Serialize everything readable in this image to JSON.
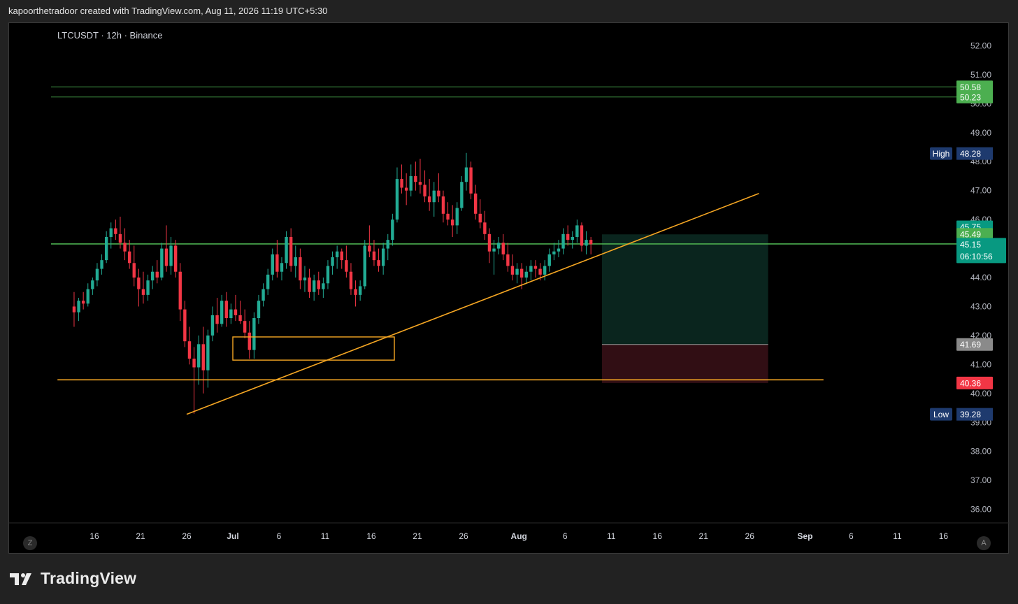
{
  "header": {
    "text": "kapoorthetradoor created with TradingView.com, Aug 11, 2026 11:19 UTC+5:30"
  },
  "chart_title": "LTCUSDT · 12h · Binance",
  "footer": {
    "brand": "TradingView"
  },
  "buttons": {
    "left": "Z",
    "right": "A"
  },
  "colors": {
    "up": "#089981",
    "down": "#f23645",
    "upGreen": "#22ab94",
    "trend": "#f5a623",
    "hline": "#4caf50",
    "high": "#1e3a6e"
  },
  "chart_data": {
    "type": "candlestick",
    "title": "LTCUSDT · 12h · Binance",
    "ylim": [
      35.3,
      52.6
    ],
    "y_ticks": [
      "52.00",
      "51.00",
      "50.00",
      "49.00",
      "48.00",
      "47.00",
      "46.00",
      "45.00",
      "44.00",
      "43.00",
      "42.00",
      "41.00",
      "40.00",
      "39.00",
      "38.00",
      "37.00",
      "36.00"
    ],
    "x_ticks": [
      {
        "label": "16",
        "day": 16
      },
      {
        "label": "21",
        "day": 21
      },
      {
        "label": "26",
        "day": 26
      },
      {
        "label": "Jul",
        "day": 31,
        "bold": true
      },
      {
        "label": "6",
        "day": 36
      },
      {
        "label": "11",
        "day": 41
      },
      {
        "label": "16",
        "day": 46
      },
      {
        "label": "21",
        "day": 51
      },
      {
        "label": "26",
        "day": 56
      },
      {
        "label": "Aug",
        "day": 62,
        "bold": true
      },
      {
        "label": "6",
        "day": 67
      },
      {
        "label": "11",
        "day": 72
      },
      {
        "label": "16",
        "day": 77
      },
      {
        "label": "21",
        "day": 82
      },
      {
        "label": "26",
        "day": 87
      },
      {
        "label": "Sep",
        "day": 93,
        "bold": true
      },
      {
        "label": "6",
        "day": 98
      },
      {
        "label": "11",
        "day": 103
      },
      {
        "label": "16",
        "day": 108
      }
    ],
    "price_labels": [
      {
        "value": "50.58",
        "price": 50.58,
        "color": "#4caf50",
        "lineColor": "#4caf50"
      },
      {
        "value": "50.23",
        "price": 50.23,
        "color": "#4caf50",
        "lineColor": "#4caf50"
      },
      {
        "value": "45.75",
        "price": 45.75,
        "color": "#089981"
      },
      {
        "value": "45.49",
        "price": 45.49,
        "color": "#4caf50"
      },
      {
        "value": "45.17",
        "price": 45.17,
        "color": "#4caf50",
        "lineColor": "#4caf50"
      },
      {
        "value": "45.15",
        "price": 45.15,
        "color": "#089981",
        "lineColor": "#4caf50",
        "extra": "06:10:56"
      },
      {
        "value": "41.69",
        "price": 41.69,
        "color": "#8a8a8a"
      },
      {
        "value": "40.36",
        "price": 40.36,
        "color": "#f23645"
      }
    ],
    "high": {
      "label": "High",
      "value": "48.28",
      "price": 48.28
    },
    "low": {
      "label": "Low",
      "value": "39.28",
      "price": 39.28
    },
    "candles": [
      [
        43.0,
        43.5,
        42.3,
        42.8
      ],
      [
        42.8,
        43.3,
        42.5,
        43.2
      ],
      [
        43.2,
        43.5,
        42.9,
        43.1
      ],
      [
        43.1,
        43.8,
        43.0,
        43.6
      ],
      [
        43.6,
        44.0,
        43.4,
        43.9
      ],
      [
        43.9,
        44.5,
        43.7,
        44.3
      ],
      [
        44.3,
        44.8,
        44.1,
        44.6
      ],
      [
        44.6,
        45.6,
        44.5,
        45.4
      ],
      [
        45.4,
        45.9,
        45.0,
        45.7
      ],
      [
        45.7,
        46.0,
        45.3,
        45.5
      ],
      [
        45.5,
        46.1,
        45.0,
        45.2
      ],
      [
        45.2,
        45.7,
        44.6,
        44.9
      ],
      [
        44.9,
        45.3,
        44.3,
        44.5
      ],
      [
        44.5,
        45.1,
        43.7,
        44.0
      ],
      [
        44.0,
        44.3,
        43.0,
        43.6
      ],
      [
        43.6,
        44.2,
        43.1,
        43.4
      ],
      [
        43.4,
        44.1,
        43.2,
        43.9
      ],
      [
        43.9,
        44.4,
        43.6,
        44.2
      ],
      [
        44.2,
        44.6,
        43.8,
        44.0
      ],
      [
        44.0,
        45.2,
        43.9,
        45.0
      ],
      [
        45.0,
        45.8,
        44.2,
        44.4
      ],
      [
        44.4,
        45.4,
        44.1,
        45.1
      ],
      [
        45.1,
        45.3,
        44.0,
        44.2
      ],
      [
        44.2,
        44.5,
        42.5,
        42.9
      ],
      [
        42.9,
        43.2,
        41.6,
        41.8
      ],
      [
        41.8,
        42.3,
        41.0,
        41.2
      ],
      [
        41.2,
        41.6,
        39.3,
        40.9
      ],
      [
        40.9,
        42.0,
        40.3,
        41.7
      ],
      [
        41.7,
        42.3,
        40.0,
        40.8
      ],
      [
        40.8,
        42.2,
        40.2,
        42.0
      ],
      [
        42.0,
        43.0,
        41.8,
        42.7
      ],
      [
        42.7,
        43.3,
        42.1,
        42.4
      ],
      [
        42.4,
        43.4,
        42.3,
        43.2
      ],
      [
        43.2,
        43.5,
        42.3,
        42.6
      ],
      [
        42.6,
        43.1,
        42.4,
        42.9
      ],
      [
        42.9,
        43.4,
        42.5,
        42.7
      ],
      [
        42.7,
        43.2,
        42.4,
        42.5
      ],
      [
        42.5,
        42.9,
        41.9,
        42.1
      ],
      [
        42.1,
        42.5,
        41.2,
        41.5
      ],
      [
        41.5,
        42.8,
        41.2,
        42.6
      ],
      [
        42.6,
        43.4,
        42.4,
        43.2
      ],
      [
        43.2,
        43.8,
        43.0,
        43.6
      ],
      [
        43.6,
        44.3,
        43.4,
        44.1
      ],
      [
        44.1,
        45.0,
        43.9,
        44.8
      ],
      [
        44.8,
        45.3,
        44.0,
        44.2
      ],
      [
        44.2,
        44.7,
        43.9,
        44.5
      ],
      [
        44.5,
        45.6,
        44.3,
        45.4
      ],
      [
        45.4,
        45.7,
        44.2,
        44.4
      ],
      [
        44.4,
        45.1,
        44.0,
        44.7
      ],
      [
        44.7,
        45.0,
        43.6,
        43.9
      ],
      [
        43.9,
        44.4,
        43.5,
        44.0
      ],
      [
        44.0,
        44.3,
        43.3,
        43.5
      ],
      [
        43.5,
        44.1,
        43.2,
        43.9
      ],
      [
        43.9,
        44.2,
        43.4,
        43.6
      ],
      [
        43.6,
        44.0,
        43.3,
        43.8
      ],
      [
        43.8,
        44.6,
        43.6,
        44.4
      ],
      [
        44.4,
        44.9,
        44.1,
        44.7
      ],
      [
        44.7,
        45.1,
        44.3,
        44.9
      ],
      [
        44.9,
        45.0,
        44.3,
        44.6
      ],
      [
        44.6,
        45.1,
        44.0,
        44.2
      ],
      [
        44.2,
        44.5,
        43.4,
        43.6
      ],
      [
        43.6,
        43.9,
        43.0,
        43.4
      ],
      [
        43.4,
        43.9,
        43.2,
        43.7
      ],
      [
        43.7,
        45.3,
        43.6,
        45.1
      ],
      [
        45.1,
        45.8,
        44.7,
        44.9
      ],
      [
        44.9,
        45.3,
        44.4,
        44.6
      ],
      [
        44.6,
        45.0,
        44.2,
        44.4
      ],
      [
        44.4,
        45.2,
        44.1,
        45.0
      ],
      [
        45.0,
        45.5,
        44.6,
        45.3
      ],
      [
        45.3,
        46.2,
        45.1,
        46.0
      ],
      [
        46.0,
        47.8,
        45.9,
        47.4
      ],
      [
        47.4,
        47.9,
        46.9,
        47.1
      ],
      [
        47.1,
        47.6,
        46.5,
        47.0
      ],
      [
        47.0,
        47.9,
        46.8,
        47.5
      ],
      [
        47.5,
        48.0,
        47.0,
        47.3
      ],
      [
        47.3,
        48.1,
        46.9,
        47.2
      ],
      [
        47.2,
        47.7,
        46.6,
        46.8
      ],
      [
        46.8,
        47.4,
        46.3,
        46.6
      ],
      [
        46.6,
        47.3,
        46.1,
        47.0
      ],
      [
        47.0,
        47.6,
        46.6,
        46.8
      ],
      [
        46.8,
        47.0,
        45.9,
        46.2
      ],
      [
        46.2,
        46.6,
        45.8,
        46.0
      ],
      [
        46.0,
        46.5,
        45.4,
        45.8
      ],
      [
        45.8,
        46.6,
        45.5,
        46.4
      ],
      [
        46.4,
        47.5,
        46.3,
        47.3
      ],
      [
        47.3,
        48.3,
        47.0,
        47.8
      ],
      [
        47.8,
        48.0,
        46.7,
        46.9
      ],
      [
        46.9,
        47.2,
        46.0,
        46.2
      ],
      [
        46.2,
        46.7,
        45.7,
        45.9
      ],
      [
        45.9,
        46.3,
        45.3,
        45.5
      ],
      [
        45.5,
        45.7,
        44.5,
        44.9
      ],
      [
        44.9,
        45.3,
        44.1,
        45.0
      ],
      [
        45.0,
        45.4,
        44.8,
        45.2
      ],
      [
        45.2,
        45.5,
        44.6,
        44.8
      ],
      [
        44.8,
        45.2,
        44.2,
        44.4
      ],
      [
        44.4,
        44.8,
        43.9,
        44.1
      ],
      [
        44.1,
        44.5,
        43.8,
        44.3
      ],
      [
        44.3,
        44.5,
        43.6,
        44.0
      ],
      [
        44.0,
        44.4,
        43.8,
        44.2
      ],
      [
        44.2,
        44.6,
        43.9,
        44.4
      ],
      [
        44.4,
        44.6,
        44.0,
        44.3
      ],
      [
        44.3,
        44.5,
        43.9,
        44.1
      ],
      [
        44.1,
        44.6,
        43.9,
        44.4
      ],
      [
        44.4,
        45.0,
        44.2,
        44.8
      ],
      [
        44.8,
        45.2,
        44.6,
        44.9
      ],
      [
        44.9,
        45.3,
        44.7,
        45.0
      ],
      [
        45.0,
        45.7,
        44.8,
        45.5
      ],
      [
        45.5,
        45.8,
        45.1,
        45.3
      ],
      [
        45.3,
        45.6,
        45.0,
        45.4
      ],
      [
        45.4,
        46.0,
        45.2,
        45.8
      ],
      [
        45.8,
        45.9,
        44.9,
        45.1
      ],
      [
        45.1,
        45.6,
        44.8,
        45.3
      ],
      [
        45.3,
        45.4,
        44.8,
        45.15
      ]
    ],
    "trendline": {
      "from": {
        "day": 26,
        "price": 39.28
      },
      "to": {
        "day": 88,
        "price": 46.9
      }
    },
    "support_line": {
      "from": {
        "day": 12,
        "price": 40.47
      },
      "to": {
        "day": 95,
        "price": 40.47
      }
    },
    "zone_box": {
      "from": {
        "day": 31,
        "price": 41.95
      },
      "to": {
        "day": 48.5,
        "price": 41.15
      }
    },
    "position": {
      "from_day": 71,
      "to_day": 89,
      "target": 45.49,
      "entry": 41.69,
      "stop": 40.36
    }
  }
}
